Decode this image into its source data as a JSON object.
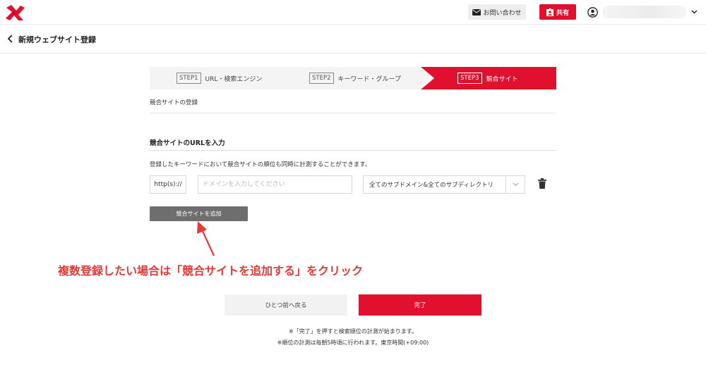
{
  "header": {
    "contact_label": "お問い合わせ",
    "share_label": "共有"
  },
  "subheader": {
    "title": "新規ウェブサイト登録"
  },
  "steps": [
    {
      "tag": "STEP1",
      "label": "URL・検索エンジン",
      "active": false
    },
    {
      "tag": "STEP2",
      "label": "キーワード・グループ",
      "active": false
    },
    {
      "tag": "STEP3",
      "label": "競合サイト",
      "active": true
    }
  ],
  "main": {
    "section_label": "競合サイトの登録",
    "heading": "競合サイトのURLを入力",
    "description": "登録したキーワードにおいて競合サイトの順位も同時に計測することができます。",
    "protocol": "http(s)://",
    "domain_placeholder": "ドメインを入力してください",
    "domain_value": "",
    "scope_selected": "全てのサブドメイン&全てのサブディレクトリ",
    "add_button_label": "競合サイトを追加"
  },
  "annotation": {
    "text": "複数登録したい場合は「競合サイトを追加する」をクリック"
  },
  "footer": {
    "prev_label": "ひとつ前へ戻る",
    "finish_label": "完了",
    "note1": "※「完了」を押すと検索順位の計測が始まります。",
    "note2": "※順位の計測は毎朝5時頃に行われます。東京時間(+09:00)"
  },
  "colors": {
    "brand_red": "#e1102f",
    "annotation_red": "#e53935",
    "add_button_gray": "#6e6e6e"
  }
}
